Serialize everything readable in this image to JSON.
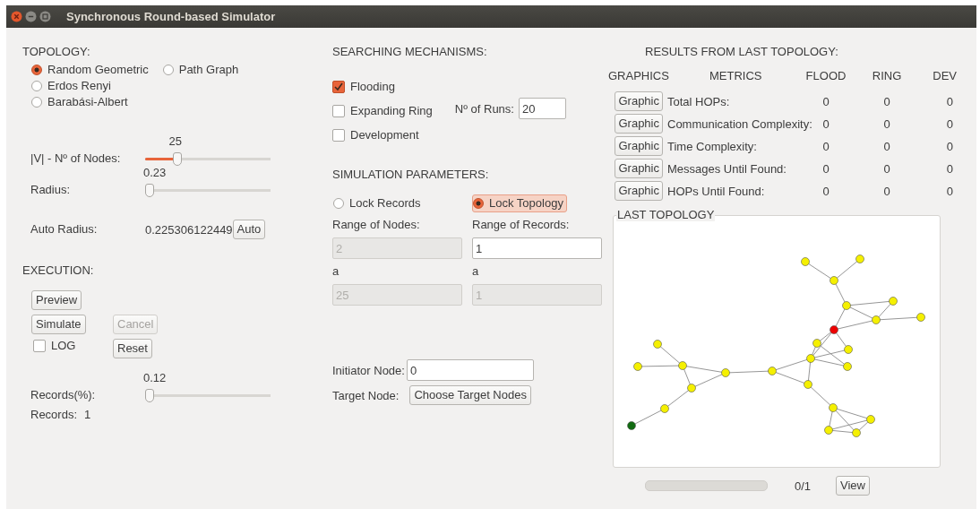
{
  "window": {
    "title": "Synchronous Round-based Simulator"
  },
  "topology": {
    "title": "TOPOLOGY:",
    "options": [
      {
        "label": "Random Geometric",
        "selected": true
      },
      {
        "label": "Path Graph",
        "selected": false
      },
      {
        "label": "Erdos Renyi",
        "selected": false
      },
      {
        "label": "Barabási-Albert",
        "selected": false
      }
    ],
    "sliders": [
      {
        "label": "|V| - Nº of Nodes:",
        "value": "25",
        "level": 0.25
      },
      {
        "label": "Radius:",
        "value": "0.23",
        "level": 0.03
      }
    ],
    "auto_radius": {
      "label": "Auto Radius:",
      "value": "0.225306122449",
      "button": "Auto"
    }
  },
  "execution": {
    "title": "EXECUTION:",
    "buttons": [
      {
        "label": "Preview",
        "disabled": false
      },
      {
        "label": "Simulate",
        "disabled": false
      },
      {
        "label": "Cancel",
        "disabled": true
      },
      {
        "label": "Reset",
        "disabled": false
      }
    ],
    "log": {
      "label": "LOG",
      "checked": false
    },
    "records_slider": {
      "label": "Records(%):",
      "value": "0.12",
      "level": 0.03
    },
    "records": {
      "label": "Records:",
      "value": "1"
    }
  },
  "searching": {
    "title": "SEARCHING MECHANISMS:",
    "mechanisms": [
      {
        "label": "Flooding",
        "checked": true
      },
      {
        "label": "Expanding Ring",
        "checked": false
      },
      {
        "label": "Development",
        "checked": false
      }
    ],
    "runs": {
      "label": "Nº of Runs:",
      "value": "20"
    }
  },
  "simulation": {
    "title": "SIMULATION PARAMETERS:",
    "modes": [
      {
        "label": "Lock Records",
        "selected": false,
        "focused": false
      },
      {
        "label": "Lock Topology",
        "selected": true,
        "focused": true
      }
    ],
    "ranges": [
      {
        "label": "Range of Nodes:",
        "from": "2",
        "to_label": "a",
        "to": "25",
        "from_disabled": true,
        "to_disabled": true
      },
      {
        "label": "Range of Records:",
        "from": "1",
        "to_label": "a",
        "to": "1",
        "from_disabled": false,
        "to_disabled": true
      }
    ],
    "initiator": {
      "label": "Initiator Node:",
      "value": "0"
    },
    "target": {
      "label": "Target Node:",
      "button": "Choose Target Nodes"
    }
  },
  "results": {
    "title": "RESULTS FROM LAST TOPOLOGY:",
    "columns": [
      "GRAPHICS",
      "METRICS",
      "FLOOD",
      "RING",
      "DEV"
    ],
    "rows": [
      {
        "button": "Graphic",
        "metric": "Total HOPs:",
        "flood": "0",
        "ring": "0",
        "dev": "0"
      },
      {
        "button": "Graphic",
        "metric": "Communication Complexity:",
        "flood": "0",
        "ring": "0",
        "dev": "0"
      },
      {
        "button": "Graphic",
        "metric": "Time Complexity:",
        "flood": "0",
        "ring": "0",
        "dev": "0"
      },
      {
        "button": "Graphic",
        "metric": "Messages Until Found:",
        "flood": "0",
        "ring": "0",
        "dev": "0"
      },
      {
        "button": "Graphic",
        "metric": "HOPs Until Found:",
        "flood": "0",
        "ring": "0",
        "dev": "0"
      }
    ],
    "last_topology": {
      "title": "LAST TOPOLOGY"
    },
    "progress": {
      "level": 0,
      "text": "0/1"
    },
    "view_button": "View"
  }
}
